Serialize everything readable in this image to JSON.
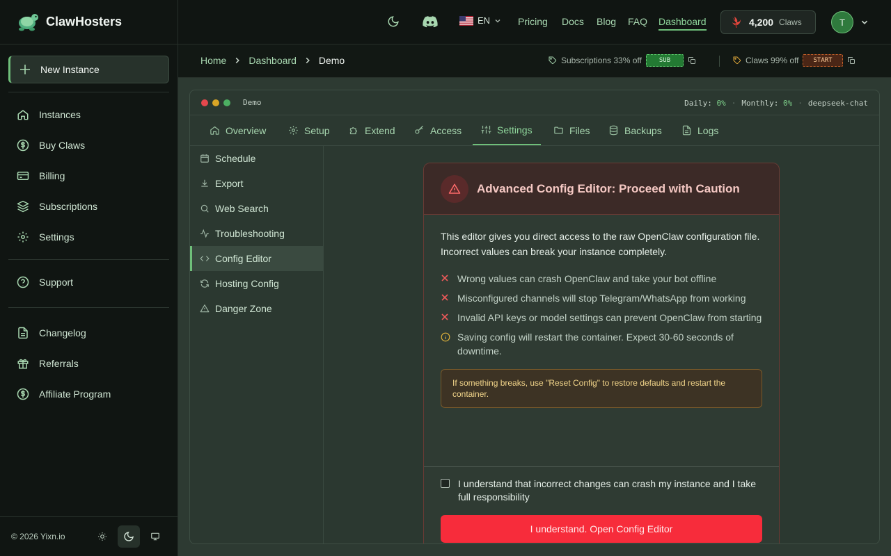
{
  "brand": {
    "name": "ClawHosters"
  },
  "sidebar": {
    "new_instance": "New Instance",
    "items": [
      {
        "label": "Instances",
        "icon": "home-icon"
      },
      {
        "label": "Buy Claws",
        "icon": "dollar-icon"
      },
      {
        "label": "Billing",
        "icon": "credit-card-icon"
      },
      {
        "label": "Subscriptions",
        "icon": "layers-icon"
      },
      {
        "label": "Settings",
        "icon": "gear-icon"
      },
      {
        "label": "Support",
        "icon": "help-circle-icon"
      },
      {
        "label": "Changelog",
        "icon": "file-icon"
      },
      {
        "label": "Referrals",
        "icon": "gift-icon"
      },
      {
        "label": "Affiliate Program",
        "icon": "dollar-icon"
      }
    ],
    "footer": "© 2026 Yixn.io"
  },
  "topbar": {
    "language": "EN",
    "links": [
      "Pricing",
      "Docs",
      "Blog",
      "FAQ",
      "Dashboard"
    ],
    "active_link": "Dashboard",
    "claws_amount": "4,200",
    "claws_label": "Claws",
    "avatar_initial": "T"
  },
  "breadcrumb": {
    "items": [
      "Home",
      "Dashboard",
      "Demo"
    ]
  },
  "promos": {
    "subscriptions": {
      "text": "Subscriptions 33% off",
      "code": "SUB"
    },
    "claws": {
      "text": "Claws 99% off",
      "code": "START"
    }
  },
  "instance": {
    "name": "Demo",
    "daily_label": "Daily:",
    "daily_value": "0%",
    "monthly_label": "Monthly:",
    "monthly_value": "0%",
    "model": "deepseek-chat"
  },
  "tabs": [
    "Overview",
    "Setup",
    "Extend",
    "Access",
    "Settings",
    "Files",
    "Backups",
    "Logs"
  ],
  "active_tab": "Settings",
  "settings_menu": [
    "Schedule",
    "Export",
    "Web Search",
    "Troubleshooting",
    "Config Editor",
    "Hosting Config",
    "Danger Zone"
  ],
  "active_settings_item": "Config Editor",
  "warning": {
    "title": "Advanced Config Editor: Proceed with Caution",
    "intro": "This editor gives you direct access to the raw OpenClaw configuration file. Incorrect values can break your instance completely.",
    "risks": [
      "Wrong values can crash OpenClaw and take your bot offline",
      "Misconfigured channels will stop Telegram/WhatsApp from working",
      "Invalid API keys or model settings can prevent OpenClaw from starting"
    ],
    "info": "Saving config will restart the container. Expect 30-60 seconds of downtime.",
    "notice": "If something breaks, use \"Reset Config\" to restore defaults and restart the container.",
    "acknowledge": "I understand that incorrect changes can crash my instance and I take full responsibility",
    "button": "I understand. Open Config Editor"
  },
  "colors": {
    "accent": "#6fbf7a",
    "danger": "#f72c3b",
    "warning": "#f2d58a"
  }
}
